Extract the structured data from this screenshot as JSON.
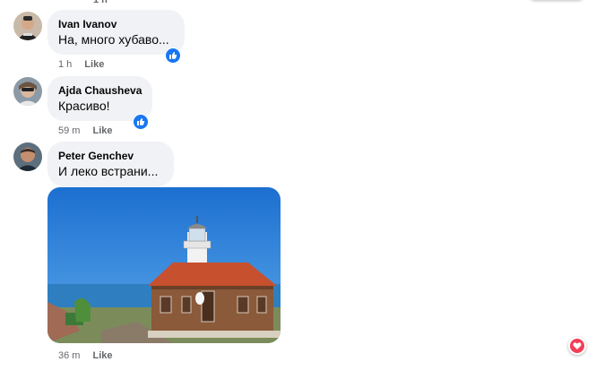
{
  "top": {
    "timestamp": "1 h"
  },
  "comments": [
    {
      "author": "Ivan Ivanov",
      "text": "На, много хубаво...",
      "time": "1 h",
      "like_label": "Like",
      "reaction": "like-icon"
    },
    {
      "author": "Ajda Chausheva",
      "text": "Красиво!",
      "time": "59 m",
      "like_label": "Like",
      "reaction": "like-icon"
    },
    {
      "author": "Peter Genchev",
      "text": "И леко встрани...",
      "time": "36 m",
      "like_label": "Like",
      "reaction": "none"
    }
  ],
  "floating_reaction": "heart-icon",
  "colors": {
    "like_blue": "#1877f2",
    "heart_red": "#f33e58",
    "bubble_gray": "#f0f2f5",
    "meta_gray": "#65676b"
  }
}
